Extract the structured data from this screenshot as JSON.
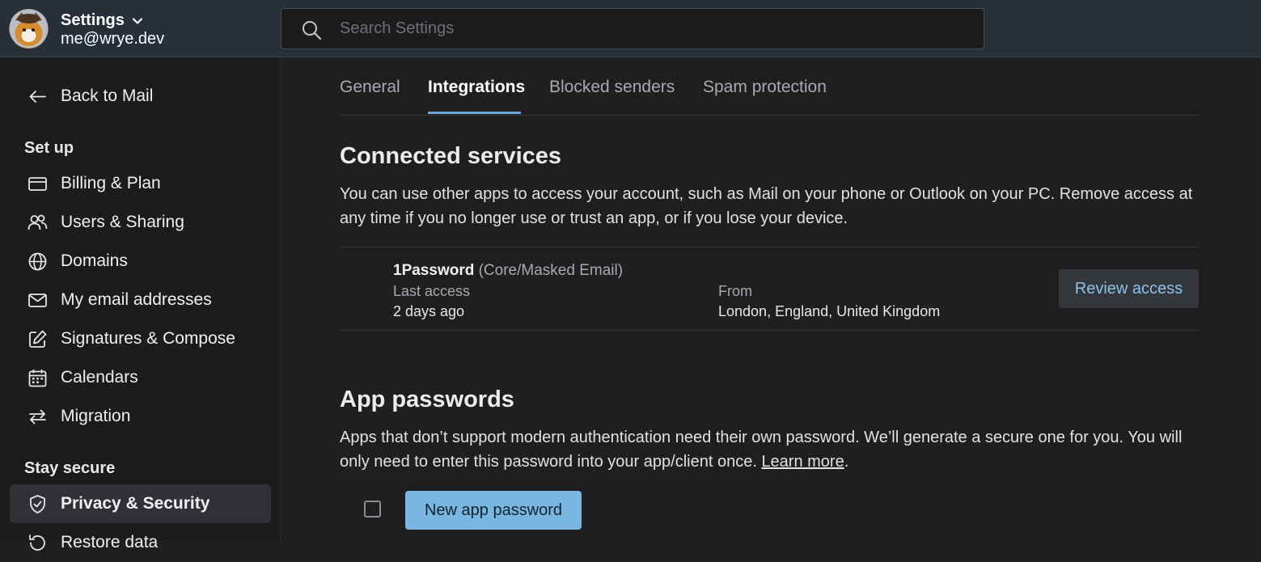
{
  "account": {
    "title": "Settings",
    "email": "me@wrye.dev"
  },
  "search": {
    "placeholder": "Search Settings",
    "value": ""
  },
  "sidebar": {
    "back_label": "Back to Mail",
    "setup_heading": "Set up",
    "setup_items": [
      {
        "label": "Billing & Plan",
        "icon": "credit-card-icon"
      },
      {
        "label": "Users & Sharing",
        "icon": "users-icon"
      },
      {
        "label": "Domains",
        "icon": "globe-icon"
      },
      {
        "label": "My email addresses",
        "icon": "envelope-icon"
      },
      {
        "label": "Signatures & Compose",
        "icon": "pencil-square-icon"
      },
      {
        "label": "Calendars",
        "icon": "calendar-icon"
      },
      {
        "label": "Migration",
        "icon": "arrows-swap-icon"
      }
    ],
    "secure_heading": "Stay secure",
    "secure_items": [
      {
        "label": "Privacy & Security",
        "icon": "shield-check-icon",
        "active": true
      },
      {
        "label": "Restore data",
        "icon": "restore-icon"
      }
    ]
  },
  "tabs": [
    {
      "label": "General"
    },
    {
      "label": "Integrations",
      "active": true
    },
    {
      "label": "Blocked senders"
    },
    {
      "label": "Spam protection"
    }
  ],
  "connected": {
    "heading": "Connected services",
    "description": "You can use other apps to access your account, such as Mail on your phone or Outlook on your PC. Remove access at any time if you no longer use or trust an app, or if you lose your device.",
    "services": [
      {
        "name": "1Password",
        "scope": "(Core/Masked Email)",
        "last_access_label": "Last access",
        "last_access_value": "2 days ago",
        "from_label": "From",
        "from_value": "London, England, United Kingdom",
        "action_label": "Review access"
      }
    ]
  },
  "app_passwords": {
    "heading": "App passwords",
    "description": "Apps that don’t support modern authentication need their own password. We’ll generate a secure one for you. You will only need to enter this password into your app/client once.",
    "learn_more": "Learn more",
    "trailing": ".",
    "new_button_label": "New app password",
    "select_all_checked": false
  },
  "colors": {
    "accent": "#6aa6d6",
    "primary_button": "#79b6e0",
    "topbar": "#273039",
    "sidebar": "#1c1c1e",
    "background": "#1f1f21"
  }
}
